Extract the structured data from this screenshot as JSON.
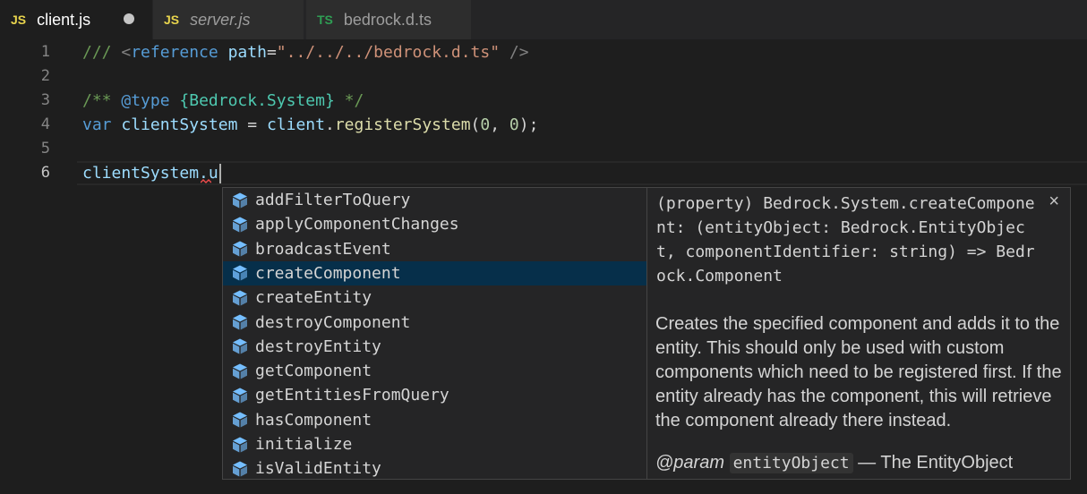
{
  "tabs": [
    {
      "lang": "JS",
      "name": "client.js",
      "active": true,
      "dirty": true
    },
    {
      "lang": "JS",
      "name": "server.js",
      "active": false
    },
    {
      "lang": "TS",
      "name": "bedrock.d.ts",
      "active": false
    }
  ],
  "editor": {
    "line_numbers": [
      "1",
      "2",
      "3",
      "4",
      "5",
      "6"
    ],
    "current_line": "6",
    "line1": {
      "c1": "///",
      "c2": "<",
      "c3": "reference",
      "c4": "path",
      "c5": "=",
      "c6": "\"../../../bedrock.d.ts\"",
      "c7": "/>"
    },
    "line3": {
      "c1": "/**",
      "c2": "@type",
      "c3": "{Bedrock.System}",
      "c4": "*/"
    },
    "line4": {
      "c1": "var",
      "c2": "clientSystem",
      "c3": "=",
      "c4": "client",
      "c5": ".",
      "c6": "registerSystem",
      "c7": "(",
      "c8": "0",
      "c9": ",",
      "c10": "0",
      "c11": ");"
    },
    "line6": {
      "text": "clientSystem.u"
    }
  },
  "suggestions": {
    "selected_index": 3,
    "icon": "cube-method-icon",
    "items": [
      "addFilterToQuery",
      "applyComponentChanges",
      "broadcastEvent",
      "createComponent",
      "createEntity",
      "destroyComponent",
      "destroyEntity",
      "getComponent",
      "getEntitiesFromQuery",
      "hasComponent",
      "initialize",
      "isValidEntity"
    ]
  },
  "details": {
    "signature": "(property) Bedrock.System.createComponent: (entityObject: Bedrock.EntityObject, componentIdentifier: string) => Bedrock.Component",
    "close_label": "×",
    "doc": "Creates the specified component and adds it to the entity. This should only be used with custom components which need to be registered first. If the entity already has the component, this will retrieve the component already there instead.",
    "param_tag": "@param",
    "param_name": "entityObject",
    "param_desc": "— The EntityObject"
  },
  "colors": {
    "editor_bg": "#1e1e1e",
    "selection": "#062f4a",
    "js_badge": "#e8d44d",
    "ts_badge": "#2f9e54",
    "method_icon": "#75beff"
  }
}
